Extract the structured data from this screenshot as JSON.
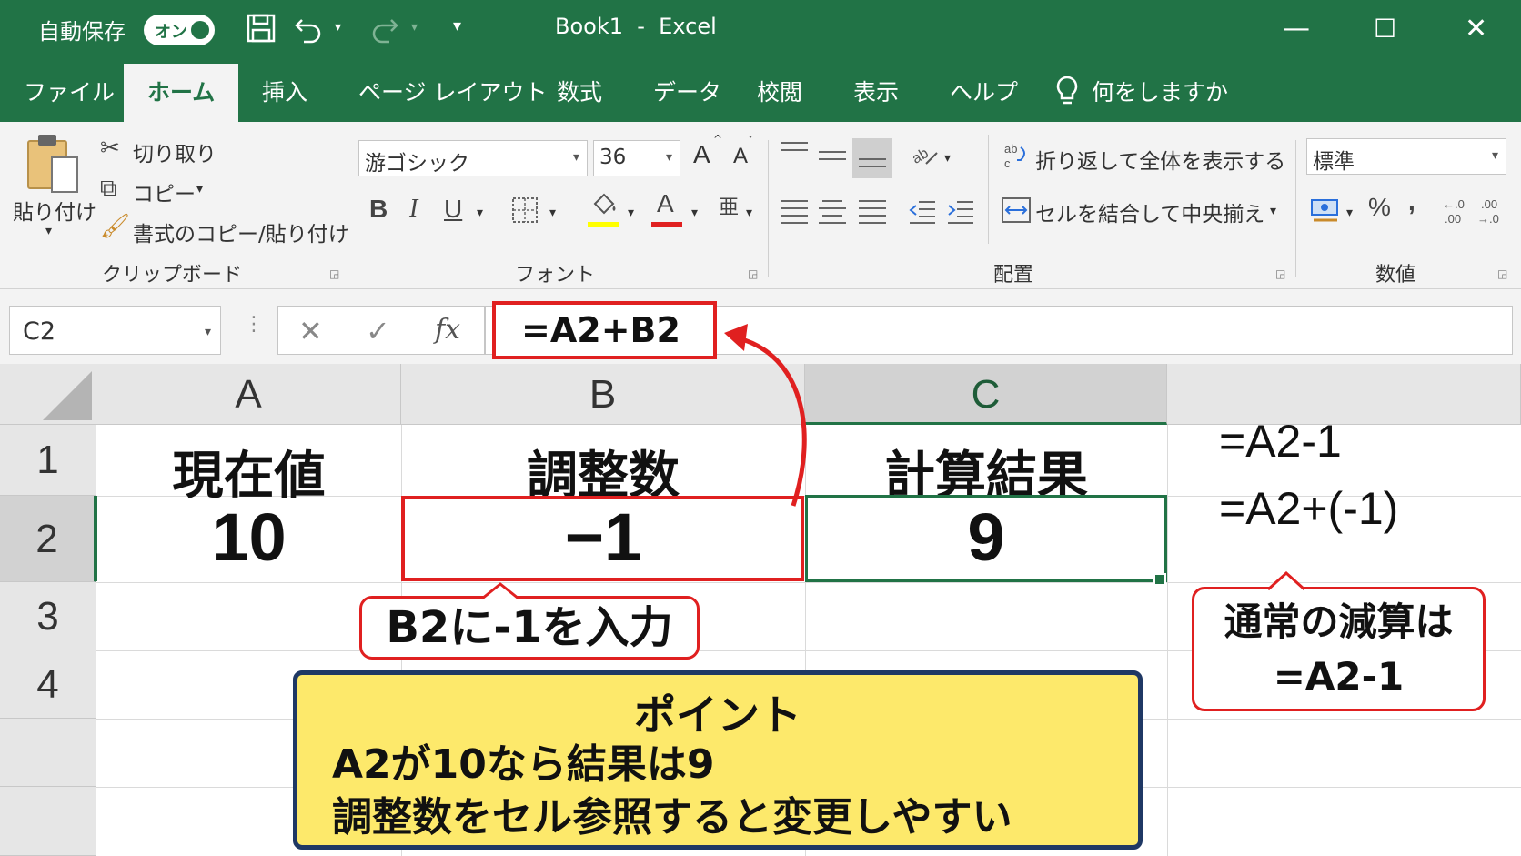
{
  "title_bar": {
    "autosave_label": "自動保存",
    "toggle_label": "オン",
    "save_icon": "floppy-disk-icon",
    "undo_icon": "undo-icon",
    "redo_icon": "redo-icon",
    "dropdown_glyph": "▾",
    "title": "Book1  -  Excel",
    "minimize": "—",
    "maximize": "☐",
    "close": "✕"
  },
  "tabs": [
    {
      "label": "ファイル"
    },
    {
      "label": "ホーム"
    },
    {
      "label": "挿入"
    },
    {
      "label": "ページ レイアウト"
    },
    {
      "label": "数式"
    },
    {
      "label": "データ"
    },
    {
      "label": "校閲"
    },
    {
      "label": "表示"
    },
    {
      "label": "ヘルプ"
    }
  ],
  "tell_me": "何をしますか",
  "ribbon": {
    "clipboard": {
      "paste": "貼り付け",
      "cut": "切り取り",
      "copy": "コピー",
      "format_painter": "書式のコピー/貼り付け",
      "label": "クリップボード"
    },
    "font": {
      "font_name": "游ゴシック",
      "font_size": "36",
      "bold": "B",
      "italic": "I",
      "underline": "U",
      "font_color_glyph": "A",
      "grow": "A",
      "shrink": "A",
      "label": "フォント",
      "fill_color": "#ffff00",
      "text_color": "#e02020"
    },
    "alignment": {
      "wrap_text": "折り返して全体を表示する",
      "merge_center": "セルを結合して中央揃え",
      "label": "配置"
    },
    "number": {
      "format": "標準",
      "percent": "%",
      "comma": ",",
      "label": "数値"
    }
  },
  "formula_bar": {
    "name_box": "C2",
    "cancel": "✕",
    "enter": "✓",
    "fx": "fx",
    "formula": "=A2+B2"
  },
  "grid": {
    "columns": [
      "A",
      "B",
      "C"
    ],
    "rows": [
      "1",
      "2",
      "3",
      "4"
    ],
    "row1": [
      "現在値",
      "調整数",
      "計算結果"
    ],
    "row2": [
      "10",
      "−1",
      "9"
    ]
  },
  "annotations": {
    "side_formula_1": "=A2-1",
    "side_formula_2": "=A2+(-1)",
    "b2_callout": "B2に-1を入力",
    "right_callout_line1": "通常の減算は",
    "right_callout_line2": "=A2-1",
    "note_title": "ポイント",
    "note_line1": "A2が10なら結果は9",
    "note_line2": "調整数をセル参照すると変更しやすい",
    "highlight_color": "#e02020",
    "note_bg": "#fde96b",
    "note_border": "#1f3864"
  }
}
